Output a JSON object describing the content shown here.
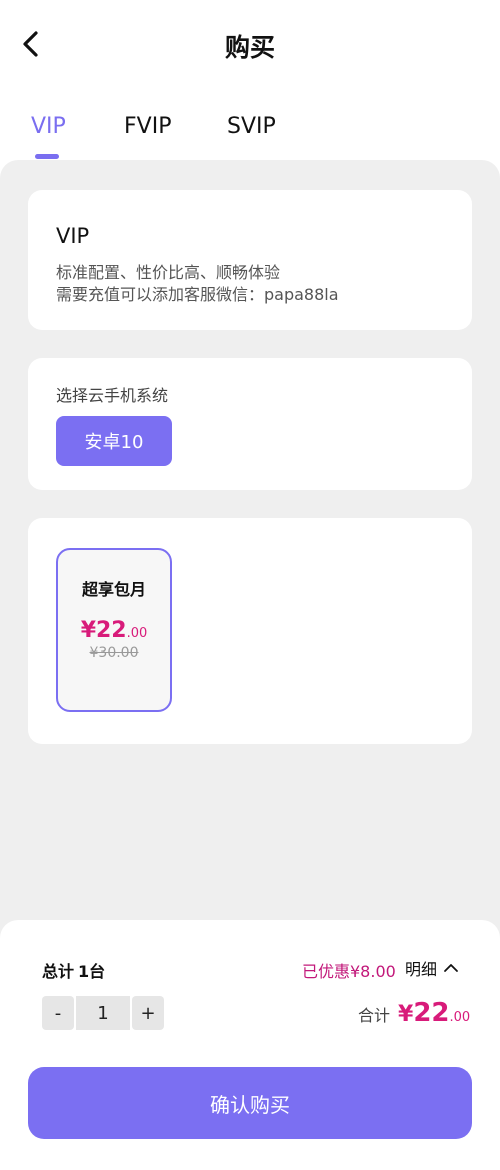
{
  "header": {
    "title": "购买"
  },
  "tabs": [
    {
      "label": "VIP",
      "active": true
    },
    {
      "label": "FVIP",
      "active": false
    },
    {
      "label": "SVIP",
      "active": false
    }
  ],
  "info_card": {
    "title": "VIP",
    "desc_line1": "标准配置、性价比高、顺畅体验",
    "desc_line2": "需要充值可以添加客服微信：papa88la"
  },
  "system_card": {
    "label": "选择云手机系统",
    "option": "安卓10"
  },
  "plan": {
    "name": "超享包月",
    "currency": "¥",
    "price_int": "22",
    "price_dec": ".00",
    "original_price": "¥30.00"
  },
  "bottom": {
    "total_label": "总计",
    "total_count": "1台",
    "discount": "已优惠¥8.00",
    "detail_label": "明细",
    "stepper": {
      "minus": "-",
      "value": "1",
      "plus": "+"
    },
    "sum_label": "合计",
    "sum_currency": "¥",
    "sum_int": "22",
    "sum_dec": ".00",
    "confirm_label": "确认购买"
  },
  "colors": {
    "accent": "#7b6ff2",
    "price": "#d81b7a",
    "background": "#efefef"
  },
  "icons": [
    "chevron-left-icon",
    "chevron-up-icon"
  ]
}
